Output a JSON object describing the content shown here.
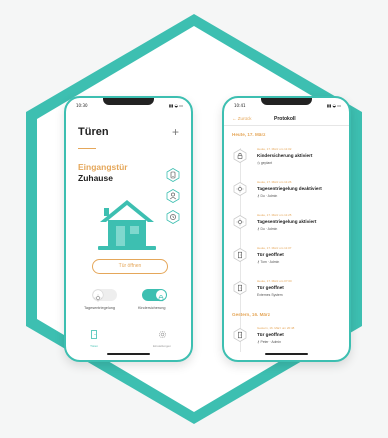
{
  "colors": {
    "accent": "#3dbfb1",
    "orange": "#e5a75a",
    "text": "#222222",
    "muted": "#9a9a9a",
    "bg": "#f5f6f6"
  },
  "left": {
    "status_time": "10:30",
    "title": "Türen",
    "add_icon": "plus-icon",
    "door_name": "Eingangstür",
    "door_location": "Zuhause",
    "side_icons": [
      "phone-door-icon",
      "person-icon",
      "history-icon"
    ],
    "open_button": "Tür öffnen",
    "toggles": [
      {
        "label": "Tagesentriegelung",
        "on": false,
        "icon": "sun-icon"
      },
      {
        "label": "Kindersicherung",
        "on": true,
        "icon": "lock-icon"
      }
    ],
    "nav": [
      {
        "label": "Türen",
        "active": true,
        "icon": "door-icon"
      },
      {
        "label": "Einstellungen",
        "active": false,
        "icon": "gear-icon"
      }
    ]
  },
  "right": {
    "status_time": "10:41",
    "back_label": "← Zurück",
    "title": "Protokoll",
    "sections": [
      {
        "heading": "Heute, 17. März",
        "entries": [
          {
            "meta": "Heute, 17. März um 11:02",
            "title": "Kindersicherung aktiviert",
            "detail": "geplant",
            "icon": "lock-icon",
            "detail_icon": "clock-icon"
          },
          {
            "meta": "Heute, 17. März um 11:26",
            "title": "Tagesentriegelung deaktiviert",
            "detail": "Du · Admin",
            "icon": "sun-icon",
            "detail_icon": "key-icon"
          },
          {
            "meta": "Heute, 17. März um 11:25",
            "title": "Tagesentriegelung aktiviert",
            "detail": "Du · Admin",
            "icon": "sun-icon",
            "detail_icon": "key-icon"
          },
          {
            "meta": "Heute, 17. März um 11:07",
            "title": "Tür geöffnet",
            "detail": "Tom · Admin",
            "icon": "door-icon",
            "detail_icon": "key-icon"
          },
          {
            "meta": "Heute, 17. März um 07:00",
            "title": "Tür geöffnet",
            "detail": "Externes System",
            "icon": "door-icon",
            "detail_icon": ""
          }
        ]
      },
      {
        "heading": "Gestern, 16. März",
        "entries": [
          {
            "meta": "Gestern, 16. März um 20:48",
            "title": "Tür geöffnet",
            "detail": "Peter · Admin",
            "icon": "door-icon",
            "detail_icon": "key-icon"
          }
        ]
      }
    ]
  }
}
